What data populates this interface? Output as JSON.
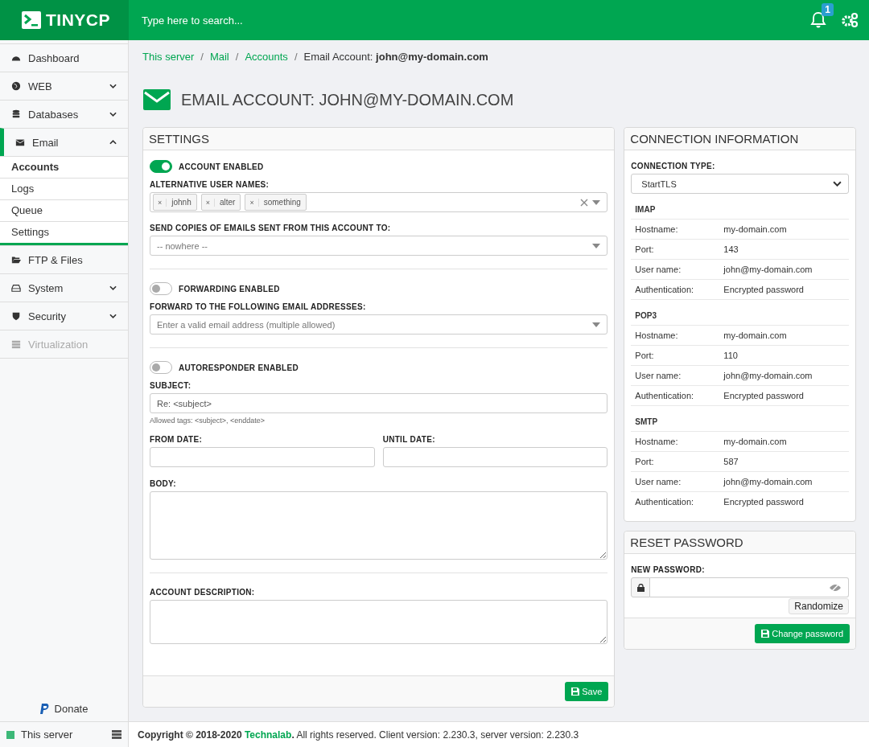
{
  "header": {
    "logo_text": "TINYCP",
    "search_placeholder": "Type here to search...",
    "notification_count": "1"
  },
  "sidebar": {
    "items": [
      {
        "label": "Dashboard",
        "selected": false,
        "disabled": false
      },
      {
        "label": "WEB",
        "selected": false,
        "disabled": false,
        "expanded": false
      },
      {
        "label": "Databases",
        "selected": false,
        "disabled": false,
        "expanded": false
      },
      {
        "label": "Email",
        "selected": true,
        "disabled": false,
        "expanded": true,
        "children": [
          {
            "label": "Accounts",
            "selected": true
          },
          {
            "label": "Logs",
            "selected": false
          },
          {
            "label": "Queue",
            "selected": false
          },
          {
            "label": "Settings",
            "selected": false
          }
        ]
      },
      {
        "label": "FTP & Files",
        "selected": false,
        "disabled": false
      },
      {
        "label": "System",
        "selected": false,
        "disabled": false,
        "expanded": false
      },
      {
        "label": "Security",
        "selected": false,
        "disabled": false,
        "expanded": false
      },
      {
        "label": "Virtualization",
        "selected": false,
        "disabled": true
      }
    ],
    "donate": "Donate",
    "server": "This server"
  },
  "breadcrumb_separator": "/",
  "breadcrumb": [
    {
      "label": "This server",
      "link": true
    },
    {
      "label": "Mail",
      "link": true
    },
    {
      "label": "Accounts",
      "link": true
    },
    {
      "label": "Email Account: **john@my-domain.com**",
      "link": false
    }
  ],
  "page_title": "EMAIL ACCOUNT: JOHN@MY-DOMAIN.COM",
  "settings": {
    "title": "SETTINGS",
    "account_enabled": {
      "label": "ACCOUNT ENABLED",
      "on": true
    },
    "alternative_user_names": {
      "label": "ALTERNATIVE USER NAMES:",
      "tags": [
        "johnh",
        "alter",
        "something"
      ],
      "remove_symbol": "×"
    },
    "send_copies": {
      "label": "SEND COPIES OF EMAILS SENT FROM THIS ACCOUNT TO:",
      "placeholder": "-- nowhere --"
    },
    "forwarding": {
      "label": "FORWARDING ENABLED",
      "on": false
    },
    "forward_to": {
      "label": "FORWARD TO THE FOLLOWING EMAIL ADDRESSES:",
      "placeholder": "Enter a valid email address (multiple allowed)"
    },
    "autoresponder": {
      "label": "AUTORESPONDER ENABLED",
      "on": false
    },
    "subject": {
      "label": "SUBJECT:",
      "value": "Re: <subject>",
      "hint": "Allowed tags: <subject>, <enddate>"
    },
    "from_date": {
      "label": "FROM DATE:"
    },
    "until_date": {
      "label": "UNTIL DATE:"
    },
    "body": {
      "label": "BODY:"
    },
    "account_description": {
      "label": "ACCOUNT DESCRIPTION:"
    },
    "save_button": "Save"
  },
  "connection": {
    "title": "CONNECTION INFORMATION",
    "type_label": "CONNECTION TYPE:",
    "type_value": "StartTLS",
    "sections": [
      {
        "name": "IMAP",
        "rows": [
          {
            "label": "Hostname:",
            "value": "my-domain.com"
          },
          {
            "label": "Port:",
            "value": "143"
          },
          {
            "label": "User name:",
            "value": "john@my-domain.com"
          },
          {
            "label": "Authentication:",
            "value": "Encrypted password"
          }
        ]
      },
      {
        "name": "POP3",
        "rows": [
          {
            "label": "Hostname:",
            "value": "my-domain.com"
          },
          {
            "label": "Port:",
            "value": "110"
          },
          {
            "label": "User name:",
            "value": "john@my-domain.com"
          },
          {
            "label": "Authentication:",
            "value": "Encrypted password"
          }
        ]
      },
      {
        "name": "SMTP",
        "rows": [
          {
            "label": "Hostname:",
            "value": "my-domain.com"
          },
          {
            "label": "Port:",
            "value": "587"
          },
          {
            "label": "User name:",
            "value": "john@my-domain.com"
          },
          {
            "label": "Authentication:",
            "value": "Encrypted password"
          }
        ]
      }
    ]
  },
  "reset_password": {
    "title": "RESET PASSWORD",
    "label": "NEW PASSWORD:",
    "randomize_button": "Randomize",
    "change_button": "Change password"
  },
  "footer": {
    "copyright": "Copyright © 2018-2020",
    "link": "Technalab",
    "rest": "**.** All rights reserved. Client version: 2.230.3, server version: 2.230.3"
  }
}
